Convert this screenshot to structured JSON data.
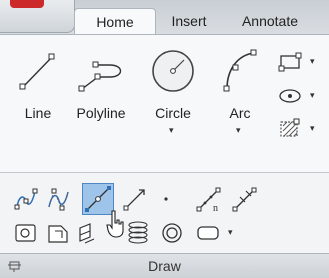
{
  "tabs": [
    {
      "label": "Home",
      "active": true
    },
    {
      "label": "Insert",
      "active": false
    },
    {
      "label": "Annotate",
      "active": false
    }
  ],
  "draw_tools": [
    {
      "label": "Line",
      "icon": "line-icon"
    },
    {
      "label": "Polyline",
      "icon": "polyline-icon"
    },
    {
      "label": "Circle",
      "icon": "circle-icon"
    },
    {
      "label": "Arc",
      "icon": "arc-icon"
    }
  ],
  "side_tools": [
    {
      "icon": "rectangle-icon"
    },
    {
      "icon": "ellipse-icon"
    },
    {
      "icon": "hatch-icon"
    }
  ],
  "panel": {
    "title": "Draw",
    "pin_icon": "pin-icon"
  },
  "colors": {
    "selected_fill": "#9fc4ea",
    "selected_border": "#4f86c6",
    "icon_blue": "#2f6fb5"
  }
}
